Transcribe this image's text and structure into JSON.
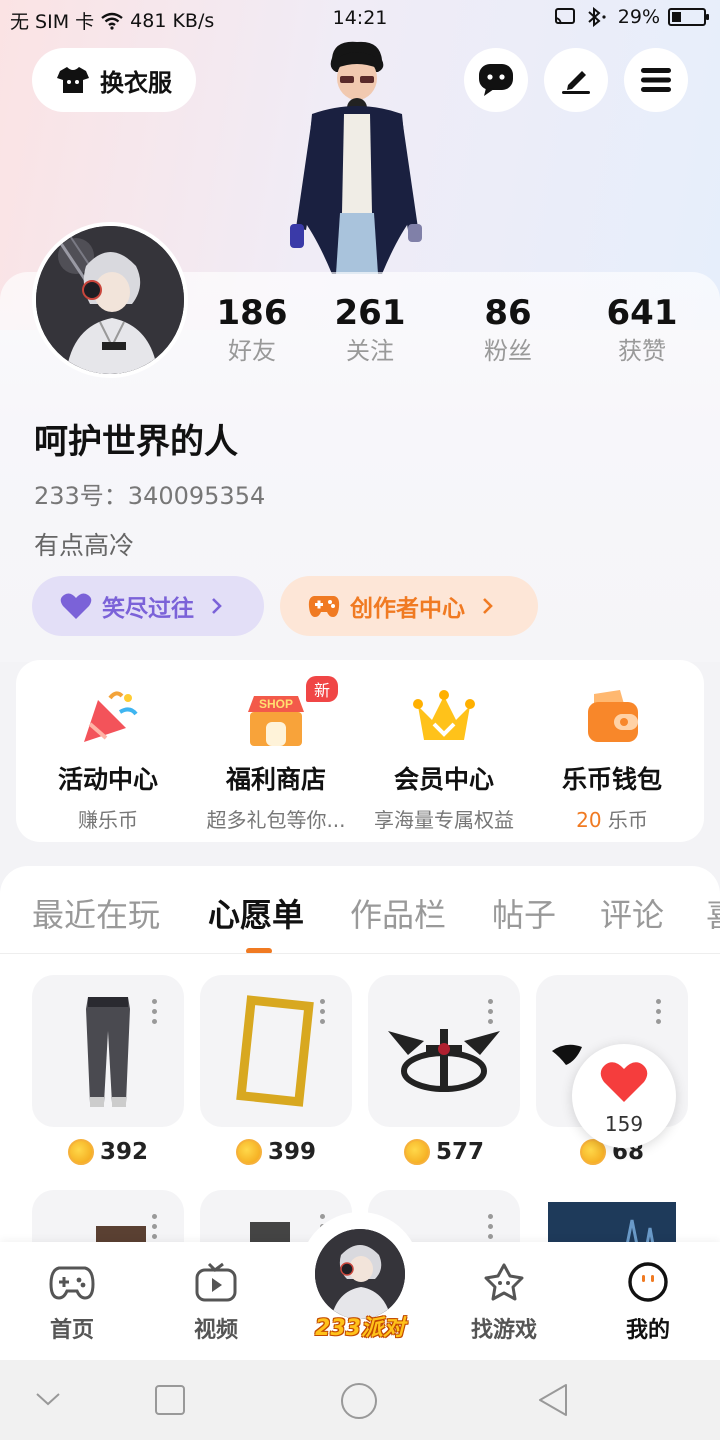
{
  "status_bar": {
    "carrier": "无 SIM 卡",
    "speed": "481 KB/s",
    "time": "14:21",
    "battery": "29%"
  },
  "header": {
    "outfit_button": "换衣服",
    "chat_icon": "chat-bubble-icon",
    "edit_icon": "pen-icon",
    "menu_icon": "menu-icon"
  },
  "profile": {
    "stats": [
      {
        "value": "186",
        "label": "好友"
      },
      {
        "value": "261",
        "label": "关注"
      },
      {
        "value": "86",
        "label": "粉丝"
      },
      {
        "value": "641",
        "label": "获赞"
      }
    ],
    "username": "呵护世界的人",
    "user_id": "233号：340095354",
    "bio": "有点高冷",
    "tag_purple": "笑尽过往",
    "tag_orange": "创作者中心"
  },
  "features": [
    {
      "title": "活动中心",
      "sub": "赚乐币",
      "icon": "party-popper-icon"
    },
    {
      "title": "福利商店",
      "sub": "超多礼包等你...",
      "icon": "shop-icon",
      "badge": "新",
      "icon_text": "SHOP"
    },
    {
      "title": "会员中心",
      "sub": "享海量专属权益",
      "icon": "crown-icon"
    },
    {
      "title": "乐币钱包",
      "sub_value": "20",
      "sub_unit": " 乐币",
      "icon": "wallet-icon"
    }
  ],
  "tabs": [
    "最近在玩",
    "心愿单",
    "作品栏",
    "帖子",
    "评论",
    "喜"
  ],
  "active_tab": "心愿单",
  "items": [
    {
      "price": "392",
      "icon": "pants-icon"
    },
    {
      "price": "399",
      "icon": "gold-frame-icon"
    },
    {
      "price": "577",
      "icon": "dark-wings-icon"
    },
    {
      "price": "68",
      "icon": "bat-wings-icon"
    }
  ],
  "like_count": "159",
  "bottom_nav": {
    "home": "首页",
    "video": "视频",
    "center": "233派对",
    "games": "找游戏",
    "mine": "我的"
  },
  "colors": {
    "accent": "#f07a22",
    "purple": "#7b62d8"
  }
}
